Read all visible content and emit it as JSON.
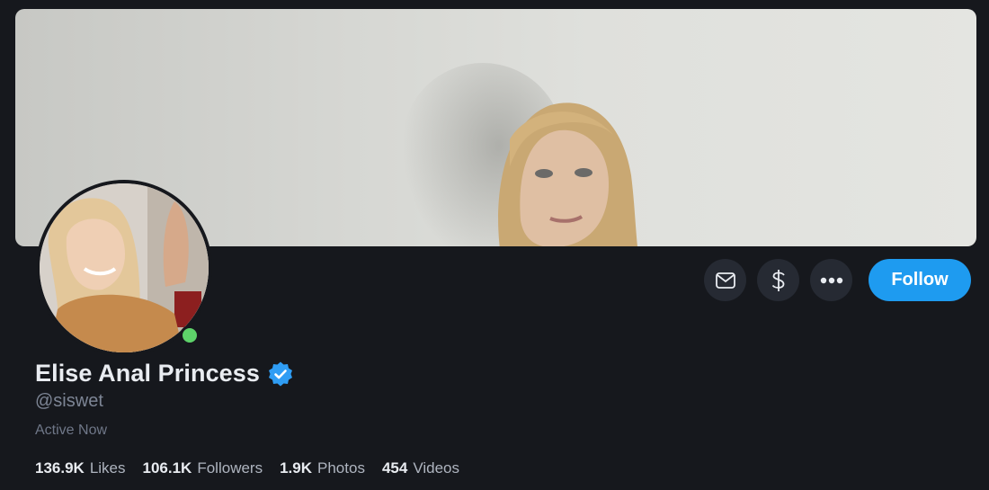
{
  "profile": {
    "display_name": "Elise Anal Princess",
    "handle": "@siswet",
    "status": "Active Now",
    "verified_icon": "verified-badge-icon",
    "online": true
  },
  "actions": {
    "message_icon": "envelope-icon",
    "tip_icon": "dollar-icon",
    "more_icon": "more-dots-icon",
    "follow_label": "Follow"
  },
  "stats": [
    {
      "value": "136.9K",
      "label": "Likes"
    },
    {
      "value": "106.1K",
      "label": "Followers"
    },
    {
      "value": "1.9K",
      "label": "Photos"
    },
    {
      "value": "454",
      "label": "Videos"
    }
  ],
  "colors": {
    "background": "#16181d",
    "accent": "#1e9bf0",
    "online": "#5ed36a",
    "verified": "#2f9df4"
  }
}
